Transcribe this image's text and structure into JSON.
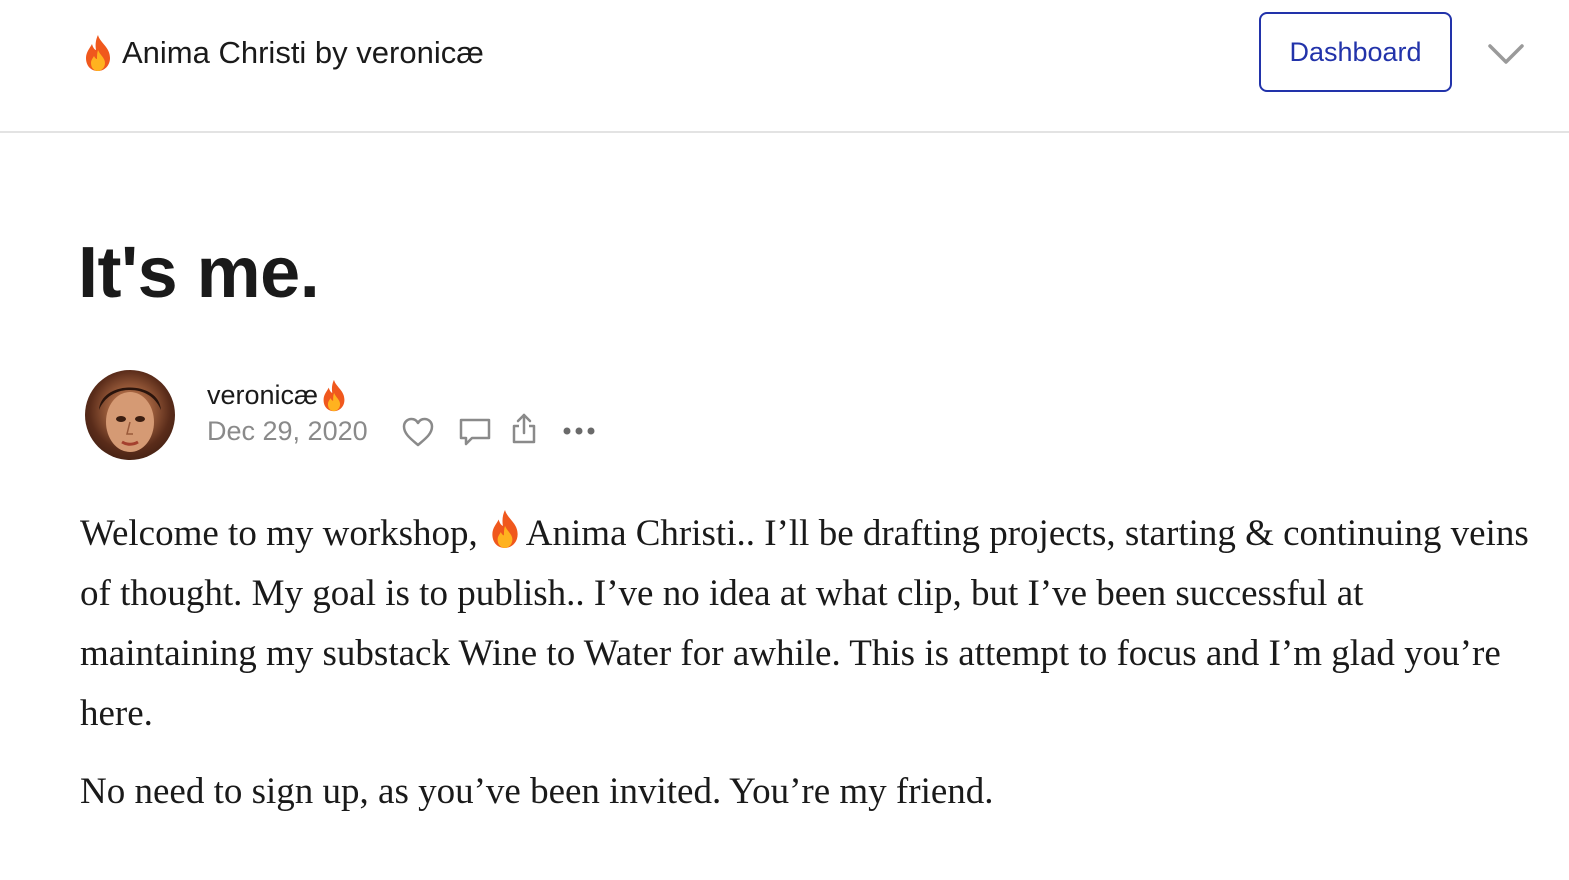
{
  "header": {
    "publication_title": "Anima Christi by veronicæ",
    "title_icon": "flame-icon",
    "dashboard_label": "Dashboard",
    "menu_icon": "chevron-down-icon",
    "accent_color": "#2233aa"
  },
  "post": {
    "title": "It's me.",
    "author": "veronicæ",
    "author_icon": "flame-icon",
    "date": "Dec 29, 2020",
    "actions": [
      "heart-icon",
      "comment-icon",
      "share-icon",
      "more-icon"
    ],
    "paragraph1_before": "Welcome to my workshop,",
    "paragraph1_after": "Anima Christi.. I’ll be drafting projects, starting & continuing veins of thought. My goal is to publish.. I’ve no idea at what clip, but I’ve been successful at maintaining my substack Wine to Water for awhile. This is attempt to focus and I’m glad you’re here.",
    "paragraph2": "No need to sign up, as you’ve been invited. You’re my friend."
  }
}
